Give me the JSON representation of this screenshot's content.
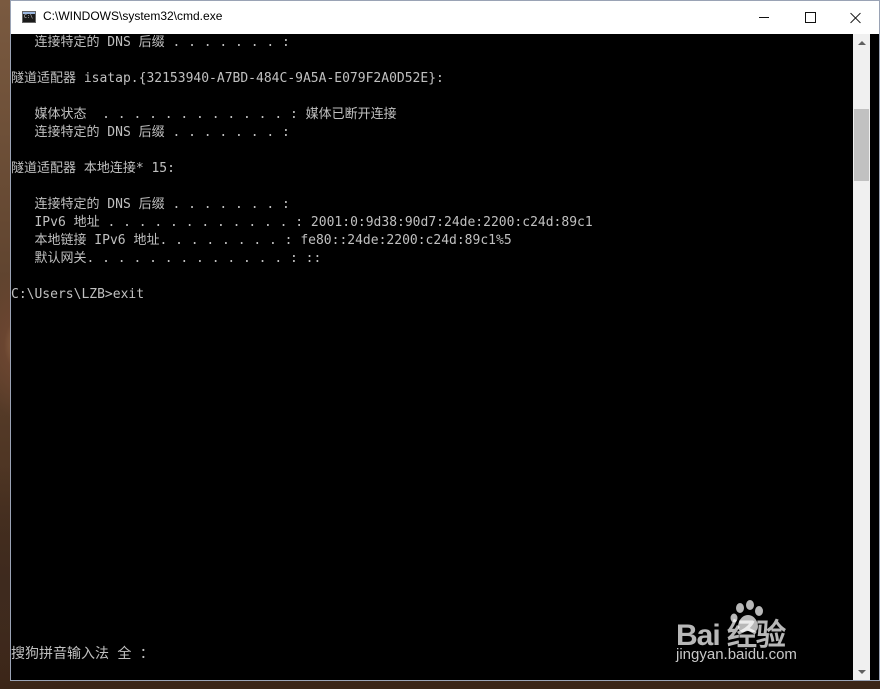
{
  "window": {
    "title": "C:\\WINDOWS\\system32\\cmd.exe"
  },
  "console": {
    "lines": [
      "   连接特定的 DNS 后缀 . . . . . . . :",
      "",
      "隧道适配器 isatap.{32153940-A7BD-484C-9A5A-E079F2A0D52E}:",
      "",
      "   媒体状态  . . . . . . . . . . . . : 媒体已断开连接",
      "   连接特定的 DNS 后缀 . . . . . . . :",
      "",
      "隧道适配器 本地连接* 15:",
      "",
      "   连接特定的 DNS 后缀 . . . . . . . :",
      "   IPv6 地址 . . . . . . . . . . . . : 2001:0:9d38:90d7:24de:2200:c24d:89c1",
      "   本地链接 IPv6 地址. . . . . . . . : fe80::24de:2200:c24d:89c1%5",
      "   默认网关. . . . . . . . . . . . . : ::",
      "",
      "C:\\Users\\LZB>exit"
    ],
    "ime_status": "搜狗拼音输入法 全 ："
  },
  "watermark": {
    "logo": "Bai  经验",
    "url": "jingyan.baidu.com"
  }
}
